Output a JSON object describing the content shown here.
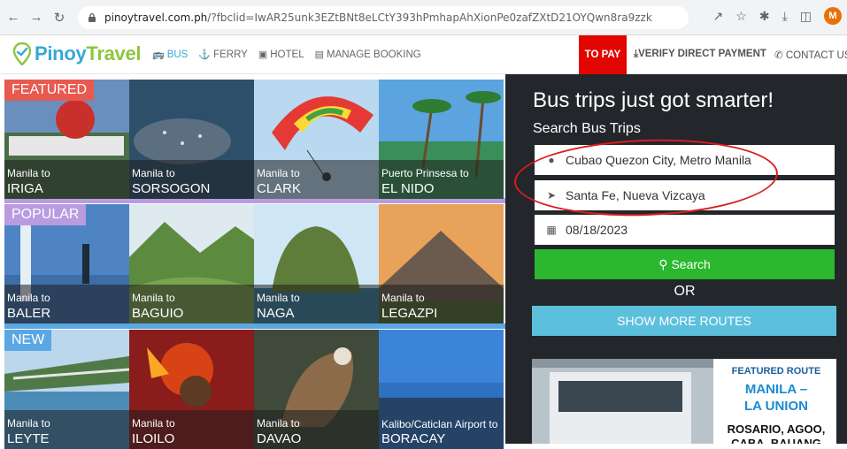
{
  "browser": {
    "url_host": "pinoytravel.com.ph",
    "url_rest": "/?fbclid=IwAR25unk3EZtBNt8eLCtY393hPmhapAhXionPe0zafZXtD21OYQwn8ra9zzk",
    "profile_initial": "M"
  },
  "site": {
    "logo_part1": "Pinoy",
    "logo_part2": "Travel",
    "nav": [
      "BUS",
      "FERRY",
      "HOTEL",
      "MANAGE BOOKING"
    ],
    "to_pay": "TO PAY",
    "verify": "VERIFY DIRECT PAYMENT",
    "contact": "CONTACT US"
  },
  "ribbons": {
    "featured": "FEATURED",
    "popular": "POPULAR",
    "new": "NEW"
  },
  "tiles": [
    {
      "from": "Manila to",
      "to": "IRIGA"
    },
    {
      "from": "Manila to",
      "to": "SORSOGON"
    },
    {
      "from": "Manila to",
      "to": "CLARK"
    },
    {
      "from": "Puerto Prinsesa to",
      "to": "EL NIDO"
    },
    {
      "from": "Manila to",
      "to": "BALER"
    },
    {
      "from": "Manila to",
      "to": "BAGUIO"
    },
    {
      "from": "Manila to",
      "to": "NAGA"
    },
    {
      "from": "Manila to",
      "to": "LEGAZPI"
    },
    {
      "from": "Manila to",
      "to": "LEYTE"
    },
    {
      "from": "Manila to",
      "to": "ILOILO"
    },
    {
      "from": "Manila to",
      "to": "DAVAO"
    },
    {
      "from": "Kalibo/Caticlan Airport to",
      "to": "BORACAY"
    }
  ],
  "search": {
    "title": "Bus trips just got smarter!",
    "subtitle": "Search Bus Trips",
    "origin": "Cubao Quezon City, Metro Manila",
    "destination": "Santa Fe, Nueva Vizcaya",
    "date": "08/18/2023",
    "search_label": "Search",
    "or_label": "OR",
    "more_label": "SHOW MORE ROUTES"
  },
  "banner": {
    "label": "FEATURED ROUTE",
    "route_line1": "MANILA –",
    "route_line2": "LA UNION",
    "stops_line1": "ROSARIO, AGOO,",
    "stops_line2": "CABA, BAUANG"
  },
  "colors": {
    "brand_blue": "#36a9d6",
    "brand_green": "#8cc63f",
    "to_pay_red": "#e10600",
    "search_green": "#2bb82f",
    "more_blue": "#5cc0dd",
    "panel_bg": "#23262b",
    "annotation_red": "#d81e1e"
  }
}
